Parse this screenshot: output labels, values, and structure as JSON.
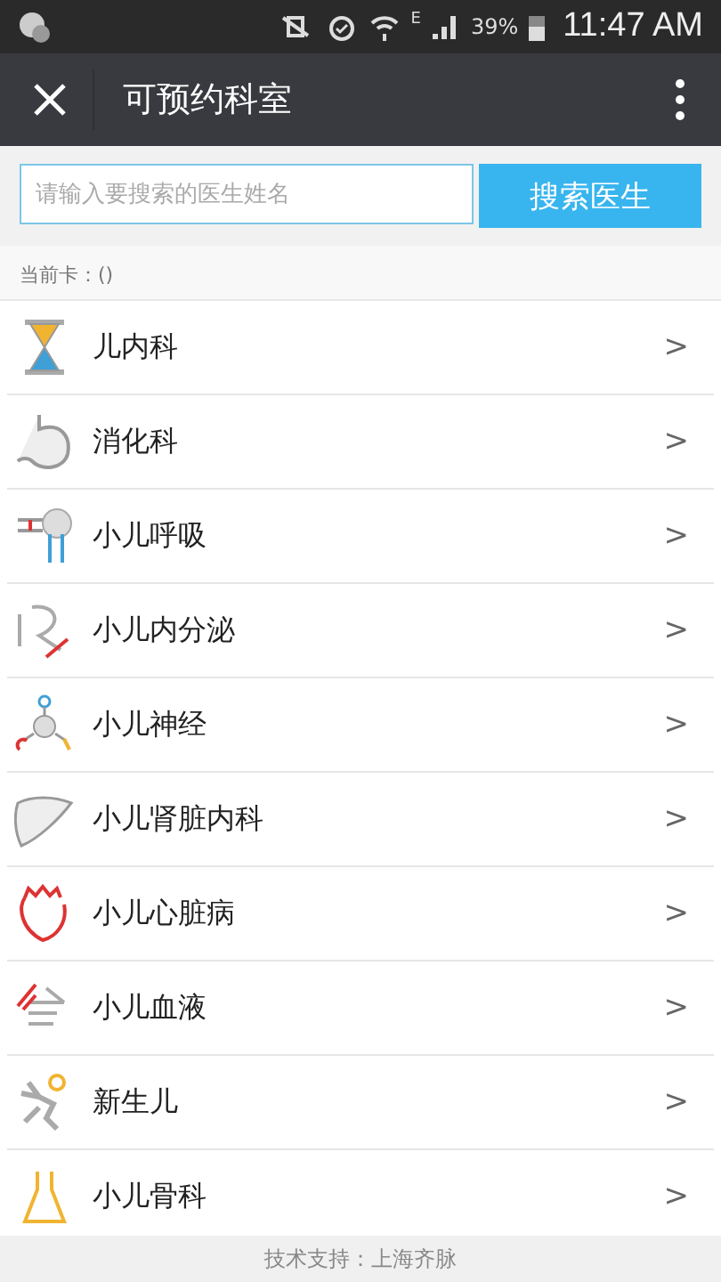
{
  "status_bar": {
    "network": "E",
    "battery": "39%",
    "time": "11:47 AM"
  },
  "header": {
    "title": "可预约科室"
  },
  "search": {
    "placeholder": "请输入要搜索的医生姓名",
    "button": "搜索医生"
  },
  "current_card": "当前卡：()",
  "departments": [
    {
      "name": "儿内科",
      "chevron": ">"
    },
    {
      "name": "消化科",
      "chevron": ">"
    },
    {
      "name": "小儿呼吸",
      "chevron": ">"
    },
    {
      "name": "小儿内分泌",
      "chevron": ">"
    },
    {
      "name": "小儿神经",
      "chevron": ">"
    },
    {
      "name": "小儿肾脏内科",
      "chevron": ">"
    },
    {
      "name": "小儿心脏病",
      "chevron": ">"
    },
    {
      "name": "小儿血液",
      "chevron": ">"
    },
    {
      "name": "新生儿",
      "chevron": ">"
    },
    {
      "name": "小儿骨科",
      "chevron": ">"
    }
  ],
  "footer": "技术支持：上海齐脉"
}
